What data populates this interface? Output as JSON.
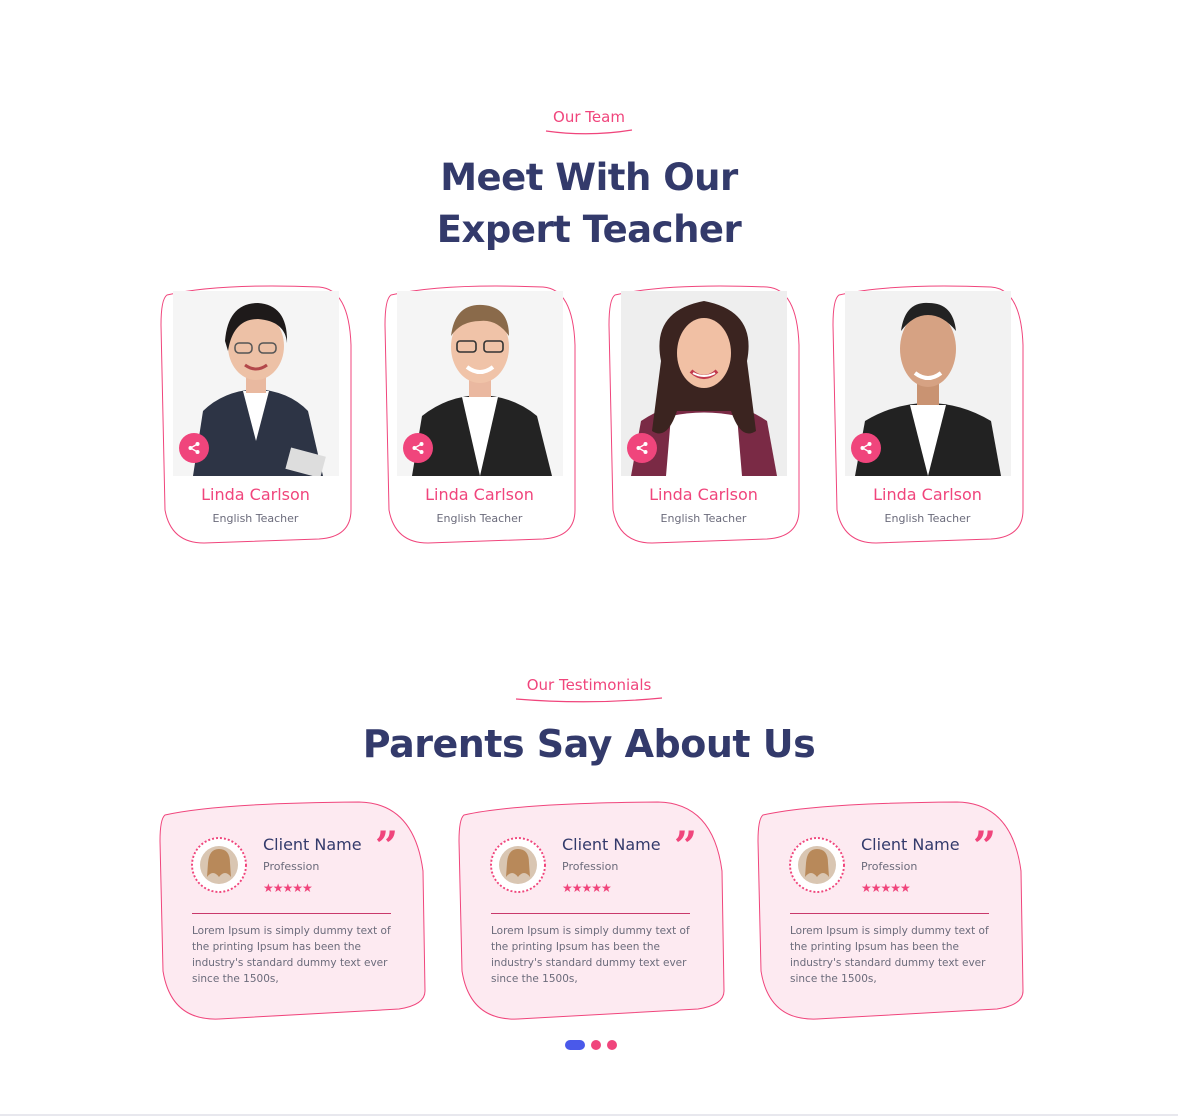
{
  "team_section": {
    "eyebrow": "Our Team",
    "headline_line1": "Meet With Our",
    "headline_line2": "Expert Teacher",
    "members": [
      {
        "name": "Linda Carlson",
        "role": "English Teacher"
      },
      {
        "name": "Linda Carlson",
        "role": "English Teacher"
      },
      {
        "name": "Linda Carlson",
        "role": "English Teacher"
      },
      {
        "name": "Linda Carlson",
        "role": "English Teacher"
      }
    ]
  },
  "testimonials_section": {
    "eyebrow": "Our Testimonials",
    "headline": "Parents Say About Us",
    "items": [
      {
        "client": "Client Name",
        "profession": "Profession",
        "stars": "★★★★★",
        "quote_mark": "”",
        "text": "Lorem Ipsum is simply dummy text of the printing Ipsum has been the industry's standard dummy text ever since the 1500s,"
      },
      {
        "client": "Client Name",
        "profession": "Profession",
        "stars": "★★★★★",
        "quote_mark": "”",
        "text": "Lorem Ipsum is simply dummy text of the printing Ipsum has been the industry's standard dummy text ever since the 1500s,"
      },
      {
        "client": "Client Name",
        "profession": "Profession",
        "stars": "★★★★★",
        "quote_mark": "”",
        "text": "Lorem Ipsum is simply dummy text of the printing Ipsum has been the industry's standard dummy text ever since the 1500s,"
      }
    ],
    "pagination": {
      "count": 3,
      "active": 1
    }
  },
  "colors": {
    "accent_pink": "#f0457c",
    "heading_navy": "#333a6b",
    "card_fill_pink": "#fdeaf1",
    "active_dot_blue": "#4a59ea"
  },
  "icons": {
    "share": "share-icon",
    "quote": "quote-icon",
    "star": "star-icon"
  }
}
